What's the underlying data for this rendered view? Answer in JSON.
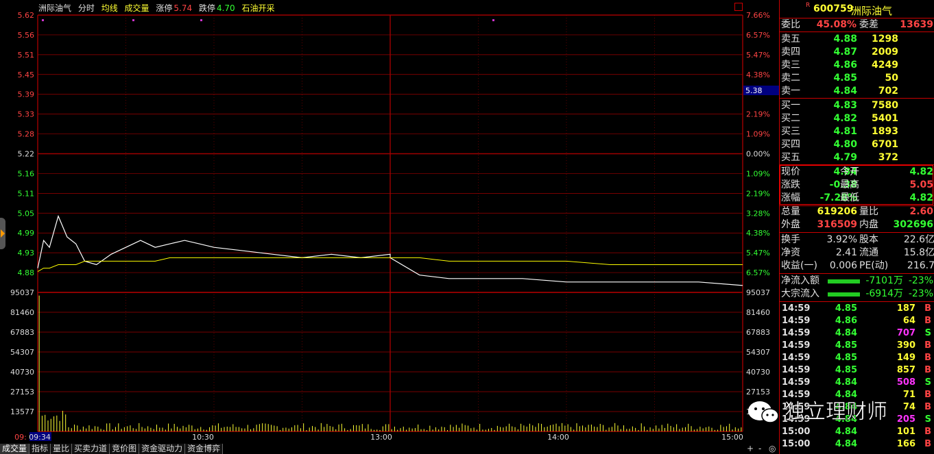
{
  "header": {
    "stock_name": "洲际油气",
    "view": "分时",
    "avg_line": "均线",
    "volume": "成交量",
    "limit_up_label": "涨停",
    "limit_up": "5.74",
    "limit_down_label": "跌停",
    "limit_down": "4.70",
    "concept": "石油开采"
  },
  "price_axis_left": [
    "5.62",
    "5.56",
    "5.51",
    "5.45",
    "5.39",
    "5.33",
    "5.28",
    "5.22",
    "5.16",
    "5.11",
    "5.05",
    "4.99",
    "4.93",
    "4.88"
  ],
  "pct_axis_right": [
    "7.66%",
    "6.57%",
    "5.47%",
    "4.38%",
    "",
    "2.19%",
    "1.09%",
    "0.00%",
    "1.09%",
    "2.19%",
    "3.28%",
    "4.38%",
    "5.47%",
    "6.57%"
  ],
  "cursor_price": "5.38",
  "vol_axis": [
    "95037",
    "81460",
    "67883",
    "54307",
    "40730",
    "27153",
    "13577"
  ],
  "time_axis": [
    "09:",
    "09:34",
    "10:30",
    "13:00",
    "14:00",
    "15:00"
  ],
  "colors": {
    "price_line": "#ffffff",
    "avg_line": "#ffff00",
    "grid": "#a00000",
    "up": "#ff4444",
    "down": "#33ff33"
  },
  "chart_data": {
    "type": "line",
    "title": "",
    "x": [
      "09:30",
      "09:32",
      "09:34",
      "09:37",
      "09:40",
      "09:43",
      "09:46",
      "09:50",
      "09:55",
      "10:00",
      "10:05",
      "10:10",
      "10:15",
      "10:20",
      "10:25",
      "10:30",
      "10:40",
      "10:50",
      "11:00",
      "11:10",
      "11:20",
      "11:30",
      "13:00",
      "13:10",
      "13:20",
      "13:30",
      "13:45",
      "14:00",
      "14:15",
      "14:30",
      "14:45",
      "15:00"
    ],
    "series": [
      {
        "values": [
          4.89,
          4.97,
          4.95,
          5.04,
          4.98,
          4.96,
          4.91,
          4.9,
          4.93,
          4.95,
          4.97,
          4.95,
          4.96,
          4.97,
          4.96,
          4.95,
          4.94,
          4.93,
          4.92,
          4.93,
          4.92,
          4.93,
          4.92,
          4.87,
          4.86,
          4.86,
          4.86,
          4.85,
          4.85,
          4.85,
          4.85,
          4.84
        ]
      },
      {
        "values": [
          4.88,
          4.89,
          4.89,
          4.9,
          4.9,
          4.9,
          4.91,
          4.91,
          4.91,
          4.91,
          4.91,
          4.91,
          4.92,
          4.92,
          4.92,
          4.92,
          4.92,
          4.92,
          4.92,
          4.92,
          4.92,
          4.92,
          4.92,
          4.92,
          4.91,
          4.91,
          4.91,
          4.91,
          4.9,
          4.9,
          4.9,
          4.9
        ]
      }
    ],
    "ylim": [
      4.82,
      5.62
    ],
    "volume_peak": 88000
  },
  "quote": {
    "code": "600759",
    "name": "洲际油气",
    "r_tag": "R",
    "weibi_label": "委比",
    "weibi": "45.08%",
    "weicha_label": "委差",
    "weicha": "13639",
    "asks": [
      {
        "label": "卖五",
        "price": "4.88",
        "vol": "1298"
      },
      {
        "label": "卖四",
        "price": "4.87",
        "vol": "2009"
      },
      {
        "label": "卖三",
        "price": "4.86",
        "vol": "4249"
      },
      {
        "label": "卖二",
        "price": "4.85",
        "vol": "50"
      },
      {
        "label": "卖一",
        "price": "4.84",
        "vol": "702"
      }
    ],
    "bids": [
      {
        "label": "买一",
        "price": "4.83",
        "vol": "7580"
      },
      {
        "label": "买二",
        "price": "4.82",
        "vol": "5401"
      },
      {
        "label": "买三",
        "price": "4.81",
        "vol": "1893"
      },
      {
        "label": "买四",
        "price": "4.80",
        "vol": "6701"
      },
      {
        "label": "买五",
        "price": "4.79",
        "vol": "372"
      }
    ],
    "stats": [
      {
        "l1": "现价",
        "v1": "4.84",
        "l2": "今开",
        "v2": "4.82"
      },
      {
        "l1": "涨跌",
        "v1": "-0.38",
        "l2": "最高",
        "v2": "5.05"
      },
      {
        "l1": "涨幅",
        "v1": "-7.28%",
        "l2": "最低",
        "v2": "4.82"
      }
    ],
    "total_vol_label": "总量",
    "total_vol": "619206",
    "vol_ratio_label": "量比",
    "vol_ratio": "2.60",
    "outer_label": "外盘",
    "outer": "316509",
    "inner_label": "内盘",
    "inner": "302696",
    "turnover_label": "换手",
    "turnover": "3.92%",
    "equity_label": "股本",
    "equity": "22.6亿",
    "nav_label": "净资",
    "nav": "2.41",
    "float_label": "流通",
    "float": "15.8亿",
    "eps_label": "收益(一)",
    "eps": "0.006",
    "pe_label": "PE(动)",
    "pe": "216.7",
    "netflow_label": "净流入额",
    "netflow": "-7101万",
    "netflow_pct": "-23%",
    "block_label": "大宗流入",
    "block": "-6914万",
    "block_pct": "-23%"
  },
  "trades": [
    {
      "t": "14:59",
      "p": "4.85",
      "v": "187",
      "s": "B"
    },
    {
      "t": "14:59",
      "p": "4.86",
      "v": "64",
      "s": "B"
    },
    {
      "t": "14:59",
      "p": "4.84",
      "v": "707",
      "s": "S"
    },
    {
      "t": "14:59",
      "p": "4.85",
      "v": "390",
      "s": "B"
    },
    {
      "t": "14:59",
      "p": "4.85",
      "v": "149",
      "s": "B"
    },
    {
      "t": "14:59",
      "p": "4.85",
      "v": "857",
      "s": "B"
    },
    {
      "t": "14:59",
      "p": "4.84",
      "v": "508",
      "s": "S"
    },
    {
      "t": "14:59",
      "p": "4.84",
      "v": "71",
      "s": "B"
    },
    {
      "t": "14:59",
      "p": "4.84",
      "v": "74",
      "s": "B"
    },
    {
      "t": "14:59",
      "p": "4.84",
      "v": "205",
      "s": "S"
    },
    {
      "t": "15:00",
      "p": "4.84",
      "v": "101",
      "s": "B"
    },
    {
      "t": "15:00",
      "p": "4.84",
      "v": "166",
      "s": "B"
    }
  ],
  "tabs": [
    "成交量",
    "指标",
    "量比",
    "买卖力道",
    "竞价图",
    "资金驱动力",
    "资金博弈"
  ],
  "toolbar_right": [
    "+",
    "-",
    "◎"
  ],
  "watermark": "独立理财师"
}
